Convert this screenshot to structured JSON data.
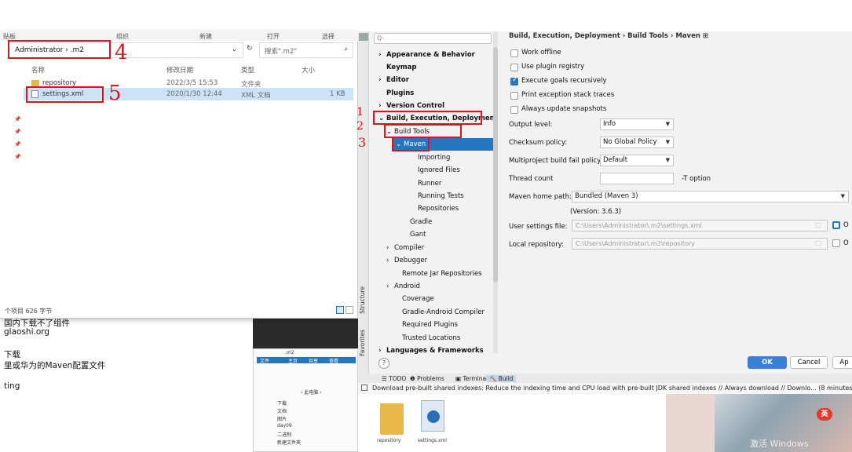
{
  "explorer": {
    "ribbon": [
      "贴板",
      "组织",
      "新建",
      "打开",
      "选择"
    ],
    "breadcrumb": "Administrator  ›  .m2",
    "search_placeholder": "搜索\".m2\"",
    "columns": {
      "name": "名称",
      "date": "修改日期",
      "type": "类型",
      "size": "大小"
    },
    "files": [
      {
        "name": "repository",
        "date": "2022/3/5 15:53",
        "type": "文件夹",
        "size": ""
      },
      {
        "name": "settings.xml",
        "date": "2020/1/30 12:44",
        "type": "XML 文档",
        "size": "1 KB"
      }
    ],
    "status": "个项目  626 字节",
    "annotations": {
      "a4": "4",
      "a5": "5"
    }
  },
  "notes": [
    "国内下载不了组件",
    "glaoshi.org",
    "下载",
    "里或华为的Maven配置文件",
    "ting"
  ],
  "settings": {
    "search_placeholder": "Q-",
    "breadcrumb": "Build, Execution, Deployment  ›  Build Tools  ›  Maven  ⊞",
    "tree": [
      {
        "label": "Appearance & Behavior",
        "prefix": "›",
        "bold": true
      },
      {
        "label": "Keymap",
        "prefix": "",
        "bold": true
      },
      {
        "label": "Editor",
        "prefix": "›",
        "bold": true
      },
      {
        "label": "Plugins",
        "prefix": "",
        "bold": true
      },
      {
        "label": "Version Control",
        "prefix": "›",
        "bold": true
      },
      {
        "label": "Build, Execution, Deployment",
        "prefix": "⌄",
        "bold": true
      },
      {
        "label": "Build Tools",
        "prefix": "⌄",
        "bold": false
      },
      {
        "label": "Maven",
        "prefix": "⌄",
        "bold": false
      },
      {
        "label": "Importing",
        "prefix": "",
        "bold": false
      },
      {
        "label": "Ignored Files",
        "prefix": "",
        "bold": false
      },
      {
        "label": "Runner",
        "prefix": "",
        "bold": false
      },
      {
        "label": "Running Tests",
        "prefix": "",
        "bold": false
      },
      {
        "label": "Repositories",
        "prefix": "",
        "bold": false
      },
      {
        "label": "Gradle",
        "prefix": "",
        "bold": false
      },
      {
        "label": "Gant",
        "prefix": "",
        "bold": false
      },
      {
        "label": "Compiler",
        "prefix": "›",
        "bold": false
      },
      {
        "label": "Debugger",
        "prefix": "›",
        "bold": false
      },
      {
        "label": "Remote Jar Repositories",
        "prefix": "",
        "bold": false
      },
      {
        "label": "Android",
        "prefix": "›",
        "bold": false
      },
      {
        "label": "Coverage",
        "prefix": "",
        "bold": false
      },
      {
        "label": "Gradle-Android Compiler",
        "prefix": "",
        "bold": false
      },
      {
        "label": "Required Plugins",
        "prefix": "",
        "bold": false
      },
      {
        "label": "Trusted Locations",
        "prefix": "",
        "bold": false
      },
      {
        "label": "Languages & Frameworks",
        "prefix": "›",
        "bold": true
      }
    ],
    "checkboxes": [
      {
        "label": "Work offline",
        "checked": false
      },
      {
        "label": "Use plugin registry",
        "checked": false
      },
      {
        "label": "Execute goals recursively",
        "checked": true
      },
      {
        "label": "Print exception stack traces",
        "checked": false
      },
      {
        "label": "Always update snapshots",
        "checked": false
      }
    ],
    "output_level": {
      "label": "Output level:",
      "value": "Info"
    },
    "checksum_policy": {
      "label": "Checksum policy:",
      "value": "No Global Policy"
    },
    "fail_policy": {
      "label": "Multiproject build fail policy:",
      "value": "Default"
    },
    "thread_count": {
      "label": "Thread count",
      "suffix": "-T option"
    },
    "maven_home": {
      "label": "Maven home path:",
      "value": "Bundled (Maven 3)",
      "version": "(Version: 3.6.3)"
    },
    "user_settings": {
      "label": "User settings file:",
      "value": "C:\\Users\\Administrator\\.m2\\settings.xml",
      "override": "O"
    },
    "local_repo": {
      "label": "Local repository:",
      "value": "C:\\Users\\Administrator\\.m2\\repository",
      "override": "O"
    },
    "side_tabs": {
      "structure": "Structure",
      "favorites": "Favorites"
    },
    "buttons": {
      "ok": "OK",
      "cancel": "Cancel",
      "apply": "Ap",
      "help": "?"
    },
    "annotations": {
      "a1": "1",
      "a2": "2",
      "a3": "3"
    }
  },
  "idebar": {
    "todo": "☰ TODO",
    "problems": "❶ Problems",
    "terminal": "▣ Terminal",
    "build": "🔨 Build"
  },
  "notice": "Download pre-built shared indexes: Reduce the indexing time and CPU load with pre-built JDK shared indexes // Always download // Downlo... (8 minutes ago)",
  "mini_explorer": {
    "title": ".m2",
    "tabs": [
      "文件",
      "主页",
      "共享",
      "查看"
    ],
    "path": "› 此电脑 ›",
    "items": [
      "下载",
      "文档",
      "图片",
      "day09",
      "二进制",
      "新建文件夹"
    ],
    "file_labels": [
      "repository",
      "settings.xml"
    ]
  },
  "watermark": "激活 Windows",
  "ime_label": "英"
}
